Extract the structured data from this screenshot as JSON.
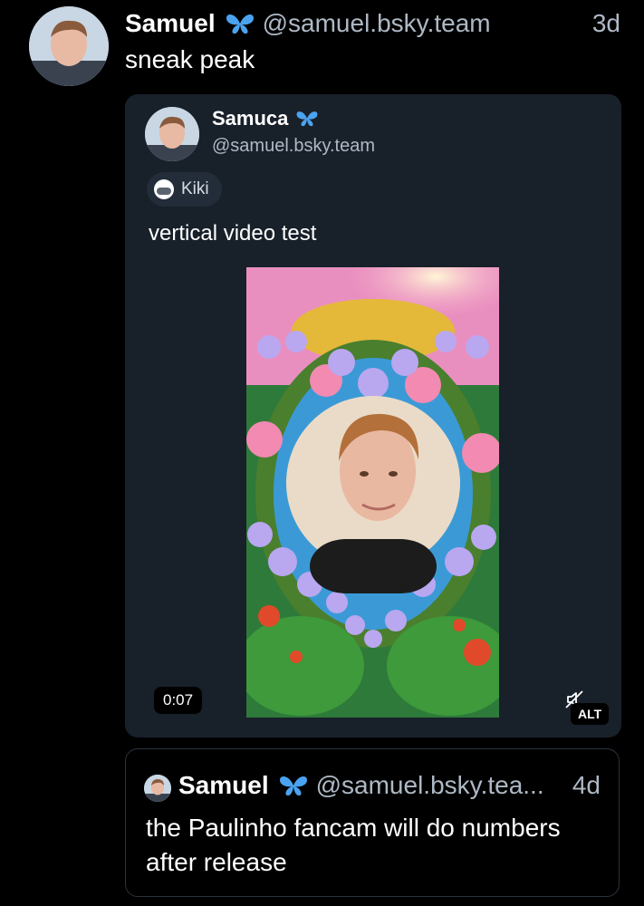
{
  "post": {
    "author_name": "Samuel",
    "verified_icon": "butterfly-icon",
    "handle": "@samuel.bsky.team",
    "time": "3d",
    "text": "sneak peak"
  },
  "quote": {
    "author_name": "Samuca",
    "handle": "@samuel.bsky.team",
    "feed_label": "Kiki",
    "text": "vertical video test",
    "video": {
      "duration": "0:07",
      "alt_label": "ALT",
      "mute_icon": "muted-speaker-icon"
    }
  },
  "nested_quote": {
    "author_name": "Samuel",
    "handle": "@samuel.bsky.tea...",
    "time": "4d",
    "text": "the Paulinho fancam will do numbers after release"
  },
  "colors": {
    "background": "#000000",
    "card": "#18202a",
    "muted_text": "#aeb9c5",
    "butterfly_blue": "#4aa3f0"
  }
}
